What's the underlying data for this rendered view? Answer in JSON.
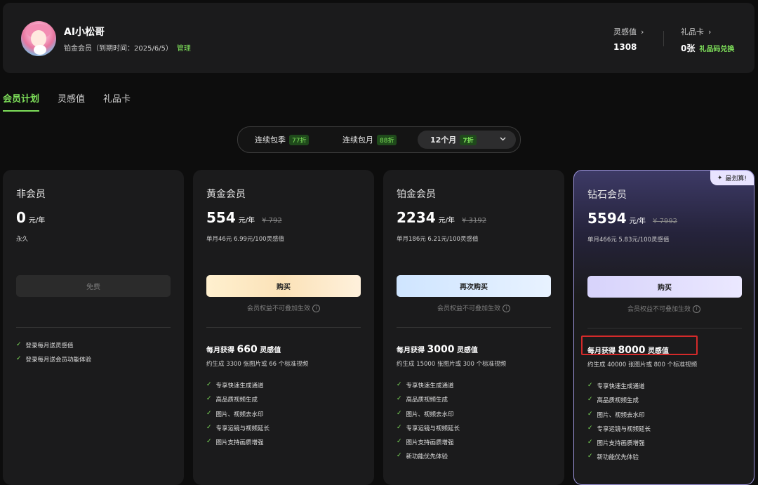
{
  "user": {
    "name": "AI小松哥",
    "membership": "铂金会员（到期时间：2025/6/5）",
    "manage_label": "管理"
  },
  "stats": {
    "inspiration": {
      "label": "灵感值",
      "value": "1308",
      "arrow": "›"
    },
    "gift_card": {
      "label": "礼品卡",
      "value": "0张",
      "arrow": "›",
      "redeem_label": "礼品码兑换"
    }
  },
  "tabs": [
    {
      "label": "会员计划",
      "active": true
    },
    {
      "label": "灵感值",
      "active": false
    },
    {
      "label": "礼品卡",
      "active": false
    }
  ],
  "period_options": [
    {
      "label": "连续包季",
      "discount": "77折"
    },
    {
      "label": "连续包月",
      "discount": "88折"
    },
    {
      "label": "12个月",
      "discount": "7折",
      "selected": true
    }
  ],
  "plans": [
    {
      "name": "非会员",
      "price": "0",
      "unit": "元/年",
      "original": "",
      "sub": "永久",
      "button": "免费",
      "features": [
        "登录每月送灵感值",
        "登录每月送会员功能体验"
      ]
    },
    {
      "name": "黄金会员",
      "price": "554",
      "unit": "元/年",
      "original": "¥ 792",
      "sub": "单月46元 6.99元/100灵感值",
      "button": "购买",
      "note": "会员权益不可叠加生效",
      "gain_prefix": "每月获得",
      "gain_value": "660",
      "gain_suffix": "灵感值",
      "gain_sub": "约生成 3300 张图片或 66 个标准视频",
      "features": [
        "专享快速生成通道",
        "高品质视频生成",
        "图片、视频去水印",
        "专享运镜与视频延长",
        "图片支持画质增强"
      ]
    },
    {
      "name": "铂金会员",
      "price": "2234",
      "unit": "元/年",
      "original": "¥ 3192",
      "sub": "单月186元 6.21元/100灵感值",
      "button": "再次购买",
      "note": "会员权益不可叠加生效",
      "gain_prefix": "每月获得",
      "gain_value": "3000",
      "gain_suffix": "灵感值",
      "gain_sub": "约生成 15000 张图片或 300 个标准视频",
      "features": [
        "专享快速生成通道",
        "高品质视频生成",
        "图片、视频去水印",
        "专享运镜与视频延长",
        "图片支持画质增强",
        "新功能优先体验"
      ]
    },
    {
      "name": "钻石会员",
      "price": "5594",
      "unit": "元/年",
      "original": "¥ 7992",
      "sub": "单月466元 5.83元/100灵感值",
      "button": "购买",
      "note": "会员权益不可叠加生效",
      "badge": "最划算!",
      "gain_prefix": "每月获得",
      "gain_value": "8000",
      "gain_suffix": "灵感值",
      "gain_sub": "约生成 40000 张图片或 800 个标准视频",
      "features": [
        "专享快速生成通道",
        "高品质视频生成",
        "图片、视频去水印",
        "专享运镜与视频延长",
        "图片支持画质增强",
        "新功能优先体验"
      ]
    }
  ],
  "colors": {
    "accent": "#7ee05a",
    "background": "#0d0d0d",
    "card": "#1b1b1c",
    "highlight_box": "#d42a2a"
  }
}
